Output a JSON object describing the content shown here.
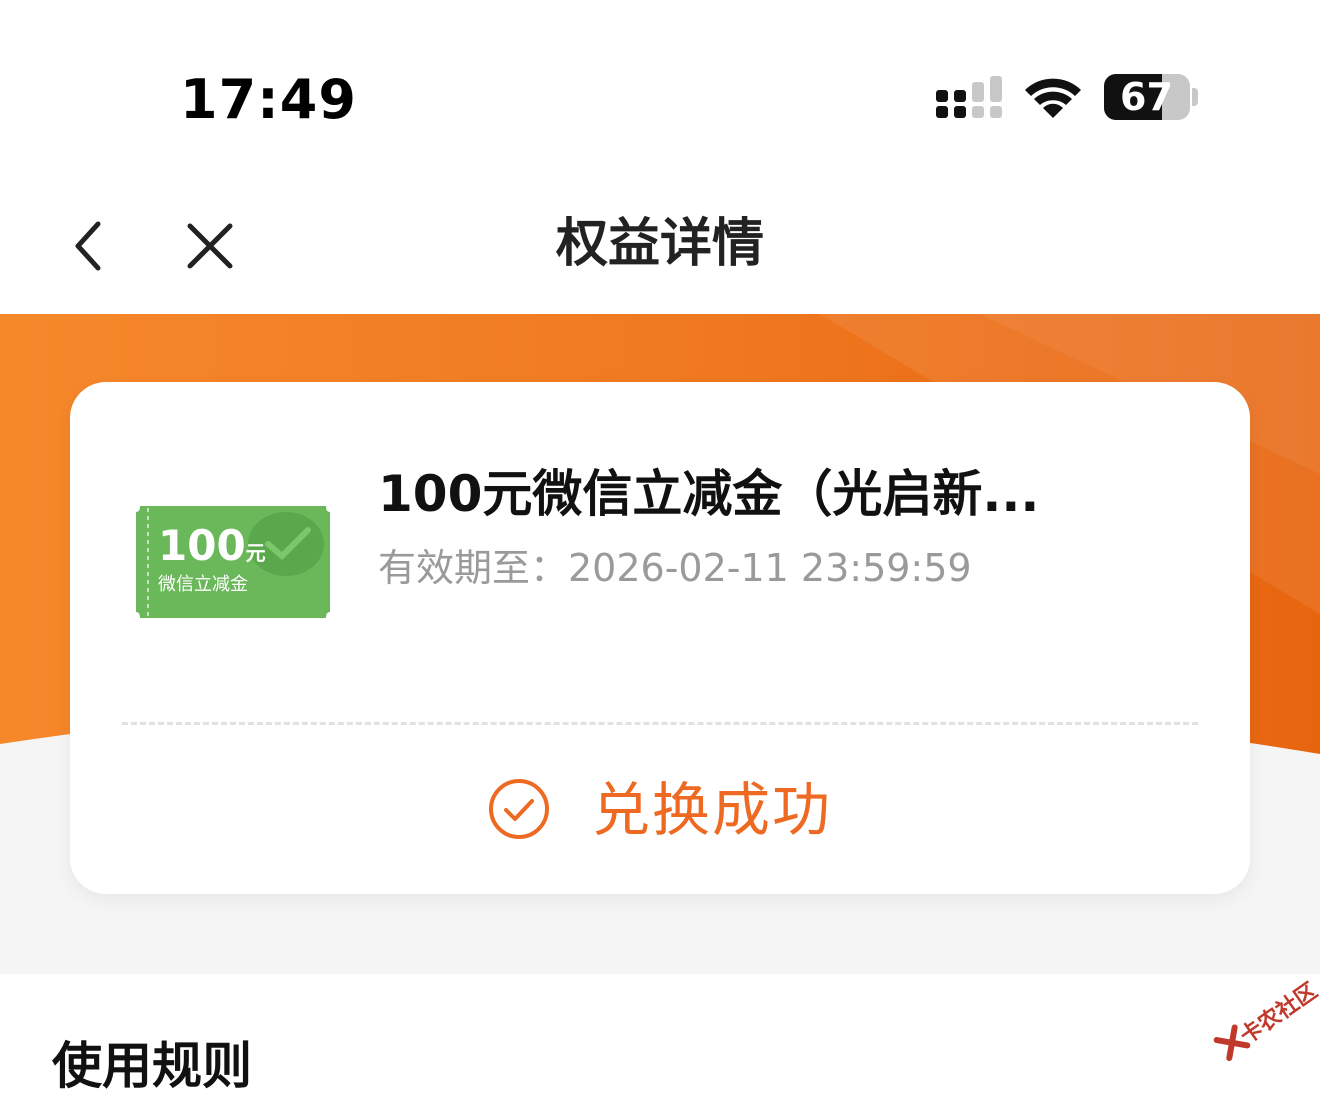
{
  "status_bar": {
    "time": "17:49",
    "battery_level": "67",
    "battery_fraction": 0.67,
    "icons": [
      "cellular-signal-icon",
      "wifi-icon",
      "battery-icon"
    ]
  },
  "nav": {
    "title": "权益详情",
    "back_icon": "chevron-left-icon",
    "close_icon": "close-icon"
  },
  "benefit": {
    "ticket_amount": "100",
    "ticket_unit": "元",
    "ticket_label": "微信立减金",
    "title": "100元微信立减金（光启新...",
    "expiry": "有效期至：2026-02-11 23:59:59",
    "status": "兑换成功",
    "status_icon": "check-circle-icon"
  },
  "rules": {
    "title": "使用规则"
  },
  "watermark": {
    "text": "卡农社区"
  },
  "colors": {
    "accent_orange": "#ee6a22",
    "banner_orange": "#f07a22",
    "ticket_green": "#6ab85a"
  }
}
